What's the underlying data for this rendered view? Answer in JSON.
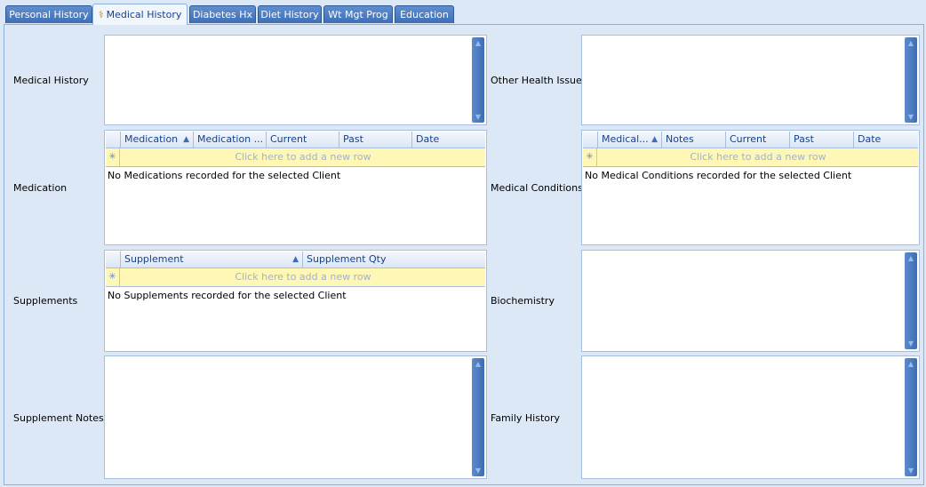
{
  "tabs": [
    "Personal History",
    "Medical History",
    "Diabetes Hx",
    "Diet History",
    "Wt Mgt Prog",
    "Education"
  ],
  "left": {
    "medical_history_label": "Medical History",
    "medication_label": "Medication",
    "supplements_label": "Supplements",
    "supplement_notes_label": "Supplement Notes"
  },
  "right": {
    "other_health_issues_label": "Other Health Issues",
    "medical_conditions_label": "Medical Conditions",
    "biochemistry_label": "Biochemistry",
    "family_history_label": "Family History"
  },
  "medication_grid": {
    "columns": [
      "Medication",
      "Medication ...",
      "Current",
      "Past",
      "Date"
    ],
    "new_row_text": "Click here to add a new row",
    "empty_text": "No Medications recorded for the selected Client"
  },
  "conditions_grid": {
    "columns": [
      "Medical...",
      "Notes",
      "Current",
      "Past",
      "Date"
    ],
    "new_row_text": "Click here to add a new row",
    "empty_text": "No Medical Conditions recorded for the selected Client"
  },
  "supplements_grid": {
    "columns": [
      "Supplement",
      "Supplement Qty"
    ],
    "new_row_text": "Click here to add a new row",
    "empty_text": "No Supplements recorded for the selected Client"
  },
  "icons": {
    "sort": "sort-ascending-icon",
    "new_row": "new-row-star-icon",
    "tab": "caduceus-icon"
  },
  "colors": {
    "tab_active": "#f1f6fd",
    "tab_inactive": "#4a7bc0",
    "new_row_bg": "#fff7b6",
    "panel_bg": "#dde8f6"
  }
}
